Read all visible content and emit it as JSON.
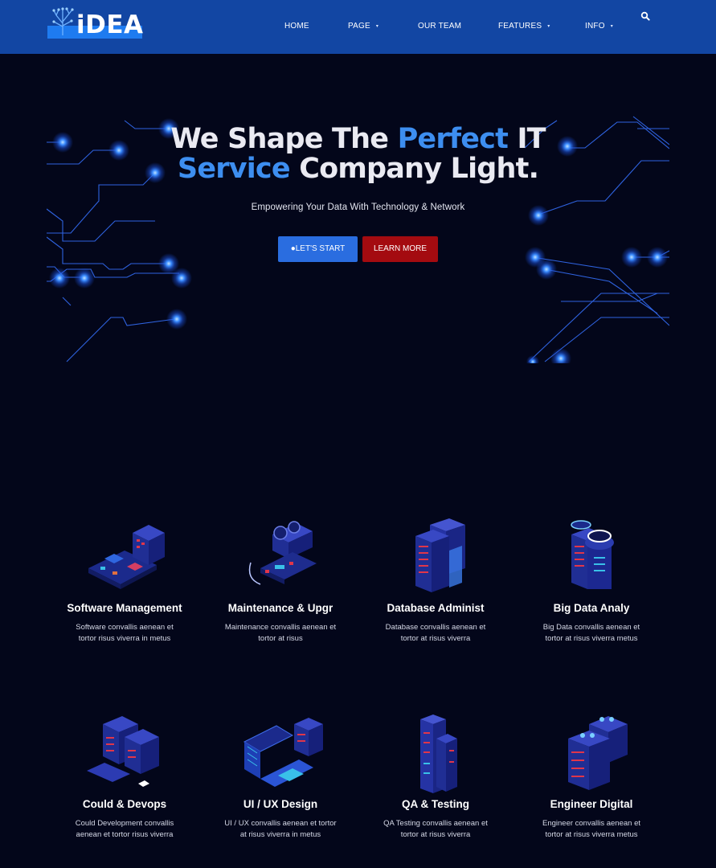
{
  "nav": {
    "logo_text": "iDEA",
    "items": [
      {
        "label": "HOME",
        "caret": false
      },
      {
        "label": "PAGE",
        "caret": true
      },
      {
        "label": "OUR TEAM",
        "caret": false
      },
      {
        "label": "FEATURES",
        "caret": true
      },
      {
        "label": "INFO",
        "caret": true
      }
    ],
    "search_icon": "search-icon"
  },
  "hero": {
    "title_line1_a": "We Shape The ",
    "title_line1_accent": "Perfect",
    "title_line1_b": " IT",
    "title_line2_accent": "Service",
    "title_line2_b": " Company Light.",
    "subtitle": "Empowering Your Data With Technology & Network",
    "btn_start": "LET'S START",
    "btn_learn": "LEARN MORE"
  },
  "colors": {
    "navbar": "#1246a3",
    "background": "#03061a",
    "accent": "#3d8ef0",
    "btn_start": "#2a6de0",
    "btn_learn": "#a40b10"
  },
  "services": [
    {
      "title": "Software Management",
      "desc": "Software convallis aenean et tortor risus viverra in metus",
      "icon": "circuit-board-icon"
    },
    {
      "title": "Maintenance & Upgr",
      "desc": "Maintenance convallis aenean et tortor at risus",
      "icon": "graphics-card-icon"
    },
    {
      "title": "Database Administ",
      "desc": "Database convallis aenean et tortor at risus viverra",
      "icon": "server-rack-icon"
    },
    {
      "title": "Big Data Analy",
      "desc": "Big Data convallis aenean et tortor at risus viverra metus",
      "icon": "data-cylinder-icon"
    },
    {
      "title": "Could & Devops",
      "desc": "Could Development convallis aenean et tortor risus viverra",
      "icon": "cloud-servers-icon"
    },
    {
      "title": "UI / UX Design",
      "desc": "UI / UX convallis aenean et tortor at risus viverra in metus",
      "icon": "laptop-design-icon"
    },
    {
      "title": "QA & Testing",
      "desc": "QA Testing convallis aenean et tortor at risus viverra",
      "icon": "testing-tower-icon"
    },
    {
      "title": "Engineer Digital",
      "desc": "Engineer convallis aenean et tortor at risus viverra metus",
      "icon": "server-stack-icon"
    }
  ]
}
